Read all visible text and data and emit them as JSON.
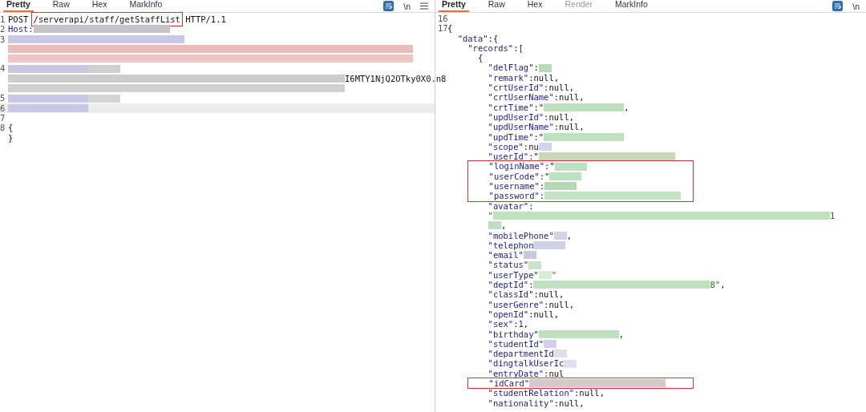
{
  "request": {
    "tabs": [
      {
        "label": "Pretty",
        "selected": true,
        "disabled": false
      },
      {
        "label": "Raw",
        "selected": false,
        "disabled": false
      },
      {
        "label": "Hex",
        "selected": false,
        "disabled": false
      },
      {
        "label": "MarkInfo",
        "selected": false,
        "disabled": false
      }
    ],
    "newline_toggle": "\\n",
    "lines": [
      {
        "number": "1",
        "current": false,
        "segments": [
          {
            "kind": "plain",
            "text": "POST "
          },
          {
            "kind": "plain",
            "text": "/serverapi/staff/getStaffList",
            "boxed": true
          },
          {
            "kind": "plain",
            "text": " HTTP/1.1"
          }
        ]
      },
      {
        "number": "2",
        "current": false,
        "segments": [
          {
            "kind": "key",
            "text": "Host:"
          },
          {
            "kind": "redacted",
            "color": "#c4c4c8"
          }
        ]
      },
      {
        "number": "3",
        "current": false,
        "segments": [
          {
            "kind": "redacted",
            "color": "#c8c8e8"
          }
        ]
      },
      {
        "current": false,
        "segments": [
          {
            "kind": "redacted",
            "color": "#ecbcbc"
          }
        ]
      },
      {
        "current": false,
        "segments": [
          {
            "kind": "redacted",
            "color": "#eec4c4"
          }
        ]
      },
      {
        "number": "4",
        "current": false,
        "segments": [
          {
            "kind": "redacted",
            "color": "#c8c8e0"
          },
          {
            "kind": "redacted",
            "color": "#cfcfcf"
          }
        ]
      },
      {
        "current": false,
        "segments": [
          {
            "kind": "redacted",
            "color": "#cdcdcd"
          },
          {
            "kind": "plain",
            "text": "I6MTY1NjQ2OTky0X0.n8"
          }
        ]
      },
      {
        "current": false,
        "segments": [
          {
            "kind": "redacted",
            "color": "#d0d0d0"
          }
        ]
      },
      {
        "number": "5",
        "current": false,
        "segments": [
          {
            "kind": "redacted",
            "color": "#c8c8e4"
          },
          {
            "kind": "redacted",
            "color": "#d4d4d4"
          }
        ]
      },
      {
        "number": "6",
        "current": true,
        "segments": [
          {
            "kind": "redacted",
            "color": "#c8c8e4"
          }
        ]
      },
      {
        "number": "7",
        "current": false
      },
      {
        "number": "8",
        "current": false,
        "segments": [
          {
            "kind": "plain",
            "text": "{"
          }
        ]
      },
      {
        "current": false,
        "segments": [
          {
            "kind": "plain",
            "text": "}"
          }
        ]
      }
    ]
  },
  "response": {
    "tabs": [
      {
        "label": "Pretty",
        "selected": true,
        "disabled": false
      },
      {
        "label": "Raw",
        "selected": false,
        "disabled": false
      },
      {
        "label": "Hex",
        "selected": false,
        "disabled": false
      },
      {
        "label": "Render",
        "selected": false,
        "disabled": true
      },
      {
        "label": "MarkInfo",
        "selected": false,
        "disabled": false
      }
    ],
    "newline_toggle": "\\n",
    "lines": [
      {
        "number": "16"
      },
      {
        "number": "17",
        "segments": [
          {
            "kind": "plain",
            "text": "{"
          }
        ]
      },
      {
        "segments": [
          {
            "kind": "key",
            "text": "  \"data\""
          },
          {
            "kind": "plain",
            "text": ":{"
          }
        ]
      },
      {
        "segments": [
          {
            "kind": "key",
            "text": "    \"records\""
          },
          {
            "kind": "plain",
            "text": ":["
          }
        ]
      },
      {
        "segments": [
          {
            "kind": "plain",
            "text": "      {"
          }
        ]
      },
      {
        "segments": [
          {
            "kind": "key",
            "text": "        \"delFlag\""
          },
          {
            "kind": "plain",
            "text": ":"
          },
          {
            "kind": "redacted",
            "color": "#b8dcb8"
          }
        ]
      },
      {
        "segments": [
          {
            "kind": "key",
            "text": "        \"remark\""
          },
          {
            "kind": "plain",
            "text": ":null,"
          }
        ]
      },
      {
        "segments": [
          {
            "kind": "key",
            "text": "        \"crtUserId\""
          },
          {
            "kind": "plain",
            "text": ":null,"
          }
        ]
      },
      {
        "segments": [
          {
            "kind": "key",
            "text": "        \"crtUserName\""
          },
          {
            "kind": "plain",
            "text": ":null,"
          }
        ]
      },
      {
        "segments": [
          {
            "kind": "key",
            "text": "        \"crtTime\""
          },
          {
            "kind": "plain",
            "text": ":\""
          },
          {
            "kind": "redacted",
            "color": "#bfe0bf"
          },
          {
            "kind": "plain",
            "text": ","
          }
        ]
      },
      {
        "segments": [
          {
            "kind": "key",
            "text": "        \"updUserId\""
          },
          {
            "kind": "plain",
            "text": ":null,"
          }
        ]
      },
      {
        "segments": [
          {
            "kind": "key",
            "text": "        \"updUserName\""
          },
          {
            "kind": "plain",
            "text": ":null,"
          }
        ]
      },
      {
        "segments": [
          {
            "kind": "key",
            "text": "        \"updTime\""
          },
          {
            "kind": "plain",
            "text": ":\""
          },
          {
            "kind": "redacted",
            "color": "#bfe0bf"
          }
        ]
      },
      {
        "segments": [
          {
            "kind": "key",
            "text": "        \"scope\""
          },
          {
            "kind": "plain",
            "text": ":nu"
          },
          {
            "kind": "redacted",
            "color": "#d4d4e8"
          }
        ]
      },
      {
        "segments": [
          {
            "kind": "key",
            "text": "        \"userId\""
          },
          {
            "kind": "plain",
            "text": ":\""
          },
          {
            "kind": "redacted",
            "color": "#c8d8b8"
          }
        ]
      },
      {
        "boxed": true,
        "segments": [
          {
            "kind": "key",
            "text": "        \"loginName\""
          },
          {
            "kind": "plain",
            "text": ":\""
          },
          {
            "kind": "redacted",
            "color": "#bfe0bf"
          }
        ]
      },
      {
        "boxed": true,
        "segments": [
          {
            "kind": "key",
            "text": "        \"userCode\""
          },
          {
            "kind": "plain",
            "text": ":\""
          },
          {
            "kind": "redacted",
            "color": "#bfe0bf"
          }
        ]
      },
      {
        "boxed": true,
        "segments": [
          {
            "kind": "key",
            "text": "        \"username\""
          },
          {
            "kind": "plain",
            "text": ":"
          },
          {
            "kind": "redacted",
            "color": "#b4d8b4"
          }
        ]
      },
      {
        "boxed": true,
        "segments": [
          {
            "kind": "key",
            "text": "        \"password\""
          },
          {
            "kind": "plain",
            "text": ":"
          },
          {
            "kind": "redacted",
            "color": "#c4e2c4"
          }
        ]
      },
      {
        "segments": [
          {
            "kind": "key",
            "text": "        \"avatar\""
          },
          {
            "kind": "plain",
            "text": ":"
          }
        ]
      },
      {
        "segments": [
          {
            "kind": "string",
            "text": "        \""
          },
          {
            "kind": "redacted",
            "color": "#bfe0bf"
          },
          {
            "kind": "string",
            "text": "1"
          }
        ]
      },
      {
        "segments": [
          {
            "kind": "redacted",
            "color": "#bfe0bf"
          },
          {
            "kind": "plain",
            "text": ","
          }
        ]
      },
      {
        "segments": [
          {
            "kind": "key",
            "text": "        \"mobilePhone\""
          },
          {
            "kind": "redacted",
            "color": "#d4d4e8"
          },
          {
            "kind": "plain",
            "text": ","
          }
        ]
      },
      {
        "segments": [
          {
            "kind": "key",
            "text": "        \"telephon"
          },
          {
            "kind": "redacted",
            "color": "#d0d0e6"
          }
        ]
      },
      {
        "segments": [
          {
            "kind": "key",
            "text": "        \"email\""
          },
          {
            "kind": "redacted",
            "color": "#c8c8e0"
          }
        ]
      },
      {
        "segments": [
          {
            "kind": "key",
            "text": "        \"status\""
          },
          {
            "kind": "redacted",
            "color": "#c8e4c8"
          }
        ]
      },
      {
        "segments": [
          {
            "kind": "key",
            "text": "        \"userType\""
          },
          {
            "kind": "redacted",
            "color": "#d8ecd8"
          },
          {
            "kind": "string",
            "text": "\""
          }
        ]
      },
      {
        "segments": [
          {
            "kind": "key",
            "text": "        \"deptId\""
          },
          {
            "kind": "plain",
            "text": ":"
          },
          {
            "kind": "redacted",
            "color": "#bfe0bf"
          },
          {
            "kind": "string",
            "text": "8\""
          },
          {
            "kind": "plain",
            "text": ","
          }
        ]
      },
      {
        "segments": [
          {
            "kind": "key",
            "text": "        \"classId\""
          },
          {
            "kind": "plain",
            "text": ":null,"
          }
        ]
      },
      {
        "segments": [
          {
            "kind": "key",
            "text": "        \"userGenre\""
          },
          {
            "kind": "plain",
            "text": ":null,"
          }
        ]
      },
      {
        "segments": [
          {
            "kind": "key",
            "text": "        \"openId\""
          },
          {
            "kind": "plain",
            "text": ":null,"
          }
        ]
      },
      {
        "segments": [
          {
            "kind": "key",
            "text": "        \"sex\""
          },
          {
            "kind": "plain",
            "text": ":"
          },
          {
            "kind": "num",
            "text": "1"
          },
          {
            "kind": "plain",
            "text": ","
          }
        ]
      },
      {
        "segments": [
          {
            "kind": "key",
            "text": "        \"birthday\""
          },
          {
            "kind": "redacted",
            "color": "#bfe0bf"
          },
          {
            "kind": "plain",
            "text": ","
          }
        ]
      },
      {
        "segments": [
          {
            "kind": "key",
            "text": "        \"studentId\""
          },
          {
            "kind": "redacted",
            "color": "#d0d0e6"
          }
        ]
      },
      {
        "segments": [
          {
            "kind": "key",
            "text": "        \"departmentId"
          },
          {
            "kind": "redacted",
            "color": "#e0e0ec"
          }
        ]
      },
      {
        "segments": [
          {
            "kind": "key",
            "text": "        \"dingtalkUserIc"
          },
          {
            "kind": "redacted",
            "color": "#e0e0ec"
          }
        ]
      },
      {
        "segments": [
          {
            "kind": "key",
            "text": "        \"entryDate\""
          },
          {
            "kind": "plain",
            "text": ":nul"
          }
        ]
      },
      {
        "boxed": true,
        "segments": [
          {
            "kind": "key",
            "text": "        \"idCard\""
          },
          {
            "kind": "redacted",
            "color": "#d8c8c8"
          }
        ]
      },
      {
        "segments": [
          {
            "kind": "key",
            "text": "        \"studentRelation\""
          },
          {
            "kind": "plain",
            "text": ":null,"
          }
        ]
      },
      {
        "segments": [
          {
            "kind": "key",
            "text": "        \"nationality\""
          },
          {
            "kind": "plain",
            "text": ":null,"
          }
        ]
      }
    ]
  }
}
